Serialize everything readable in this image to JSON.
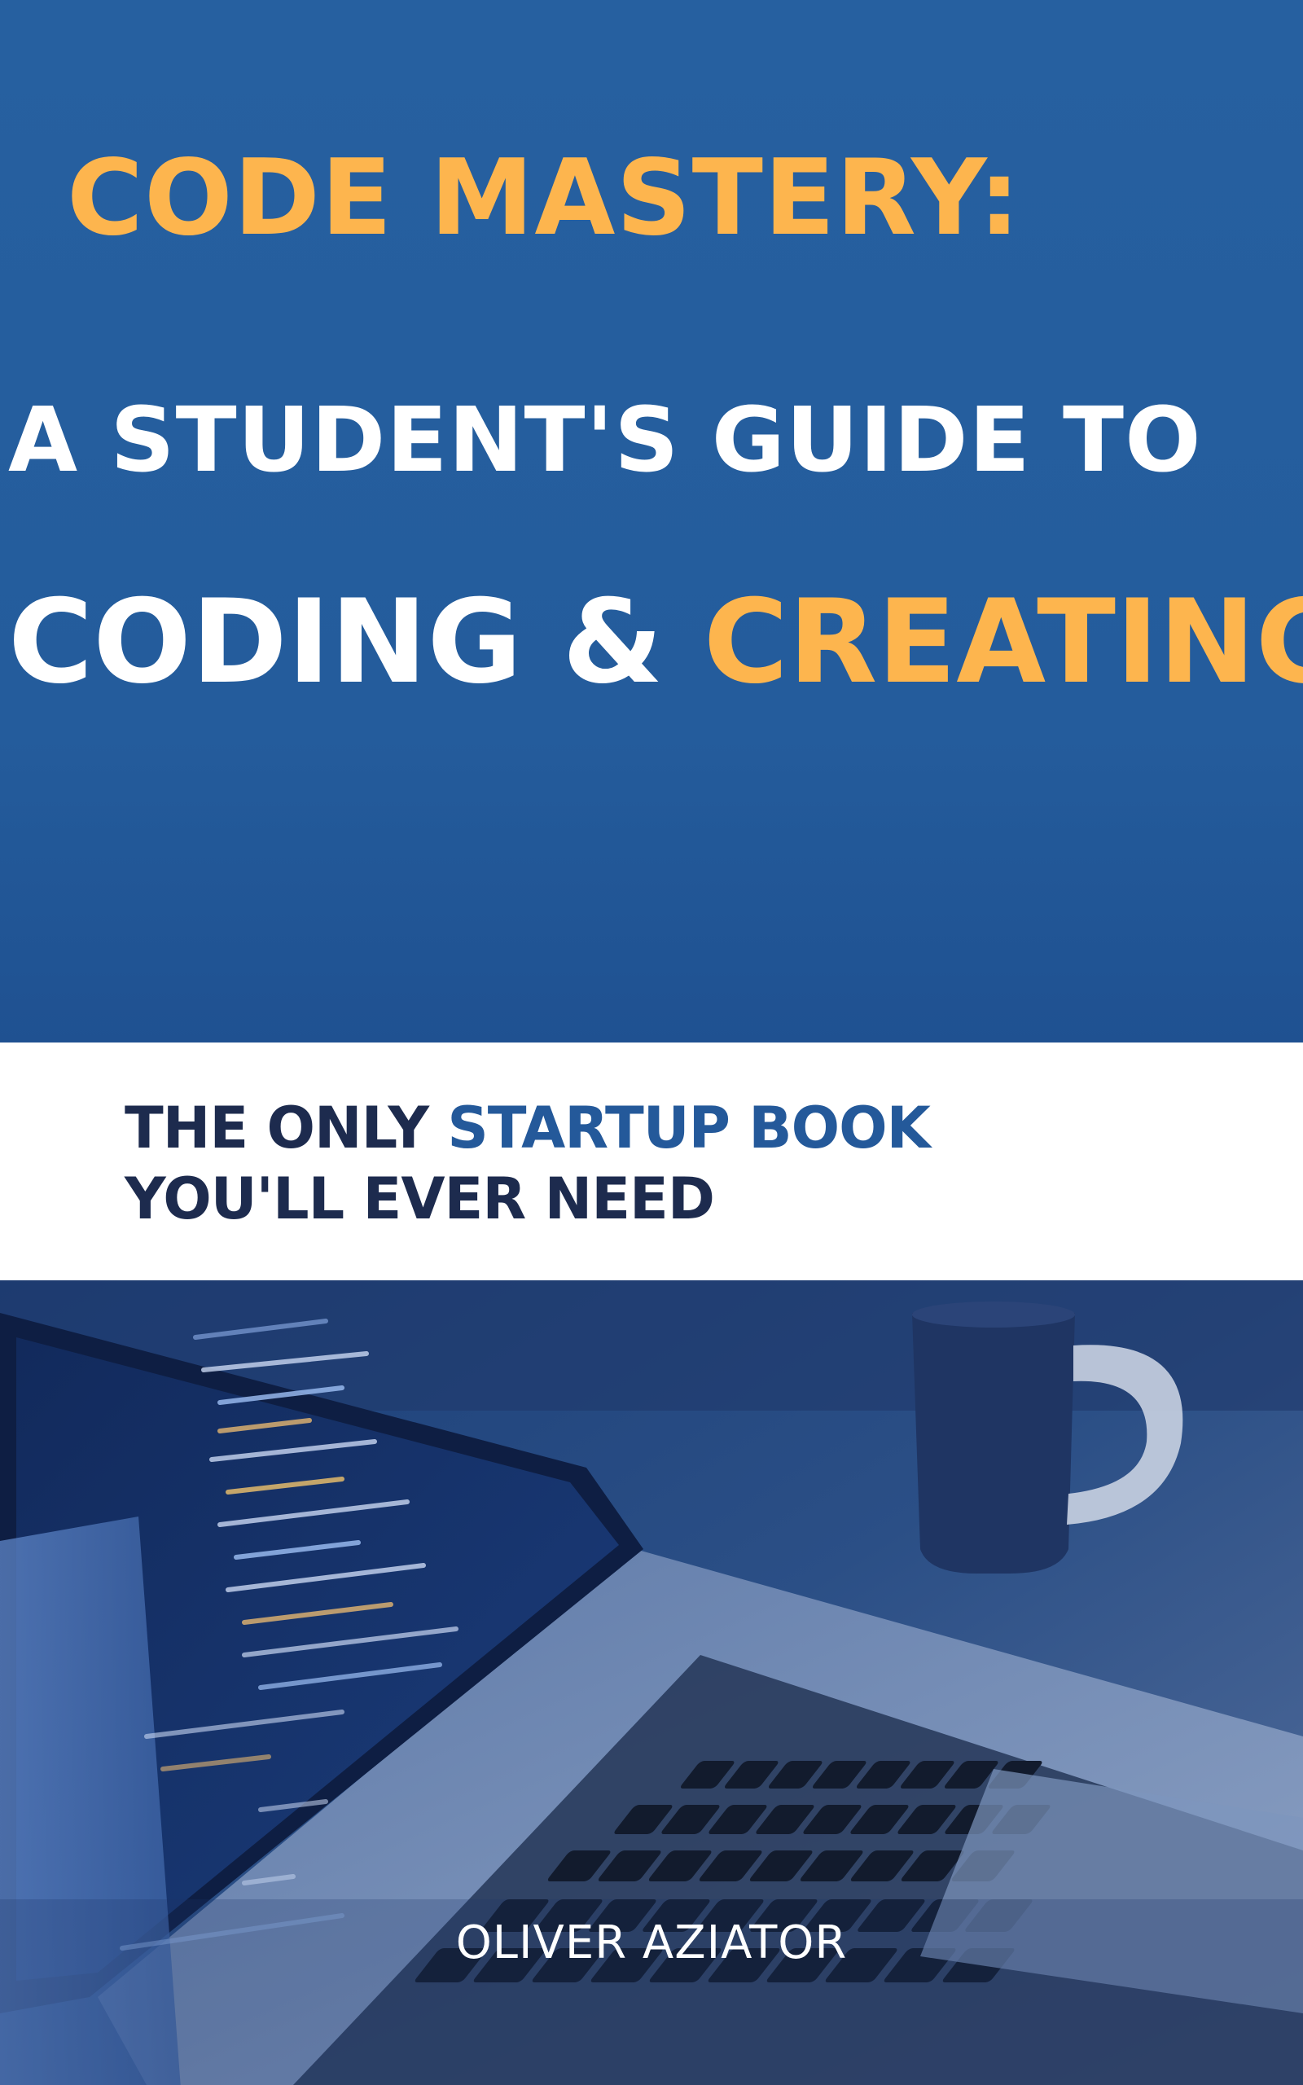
{
  "cover": {
    "title_line1": "CODE MASTERY:",
    "title_line2": "A STUDENT'S GUIDE  TO",
    "title_line3_part1": "CODING & ",
    "title_line3_part2": "CREATING",
    "subtitle_line1_part1": "THE ONLY ",
    "subtitle_line1_part2": "STARTUP BOOK",
    "subtitle_line2": "YOU'LL EVER NEED",
    "author": "OLIVER AZIATOR"
  },
  "colors": {
    "cover_blue": "#245c9c",
    "accent_orange": "#fdb54e",
    "navy_text": "#1d2b4e",
    "accent_blue_text": "#24599a",
    "white": "#ffffff"
  },
  "photo": {
    "subject": "laptop-with-code-and-coffee-mug"
  }
}
